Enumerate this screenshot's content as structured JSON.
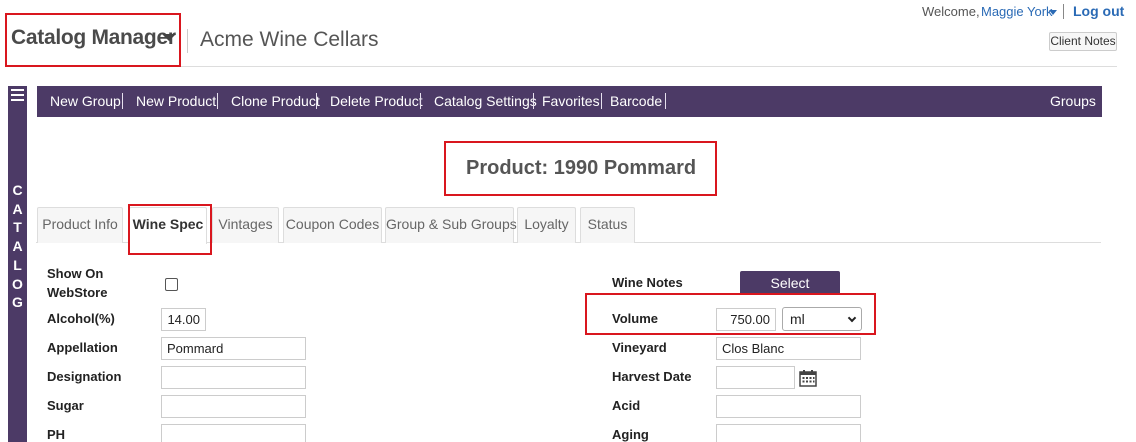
{
  "header": {
    "app_title": "Catalog Manager",
    "client_name": "Acme Wine Cellars",
    "welcome_text": "Welcome,",
    "user_name": "Maggie York",
    "logout_label": "Log out",
    "client_notes_label": "Client Notes"
  },
  "side_panel": {
    "label": "CATALOG"
  },
  "nav": {
    "items": [
      "New Group",
      "New Product",
      "Clone Product",
      "Delete Product",
      "Catalog Settings",
      "Favorites",
      "Barcode"
    ],
    "right_item": "Groups"
  },
  "page": {
    "product_title": "Product: 1990 Pommard"
  },
  "tabs": [
    "Product Info",
    "Wine Spec",
    "Vintages",
    "Coupon Codes",
    "Group & Sub Groups",
    "Loyalty",
    "Status"
  ],
  "active_tab": "Wine Spec",
  "form_left": {
    "show_on_webstore_label": "Show On WebStore",
    "show_on_webstore_checked": false,
    "alcohol_label": "Alcohol(%)",
    "alcohol_value": "14.00",
    "appellation_label": "Appellation",
    "appellation_value": "Pommard",
    "designation_label": "Designation",
    "designation_value": "",
    "sugar_label": "Sugar",
    "sugar_value": "",
    "ph_label": "PH",
    "ph_value": ""
  },
  "form_right": {
    "wine_notes_label": "Wine Notes",
    "wine_notes_button": "Select",
    "volume_label": "Volume",
    "volume_value": "750.00",
    "volume_unit": "ml",
    "vineyard_label": "Vineyard",
    "vineyard_value": "Clos Blanc",
    "harvest_date_label": "Harvest Date",
    "harvest_date_value": "",
    "acid_label": "Acid",
    "acid_value": "",
    "aging_label": "Aging",
    "aging_value": ""
  },
  "colors": {
    "brand_purple": "#4c3a66",
    "highlight_red": "#d9161e",
    "link_blue": "#2a6ab5"
  },
  "icons": [
    "caret-down-icon",
    "hamburger-menu-icon",
    "calendar-icon",
    "chevron-down-icon"
  ]
}
